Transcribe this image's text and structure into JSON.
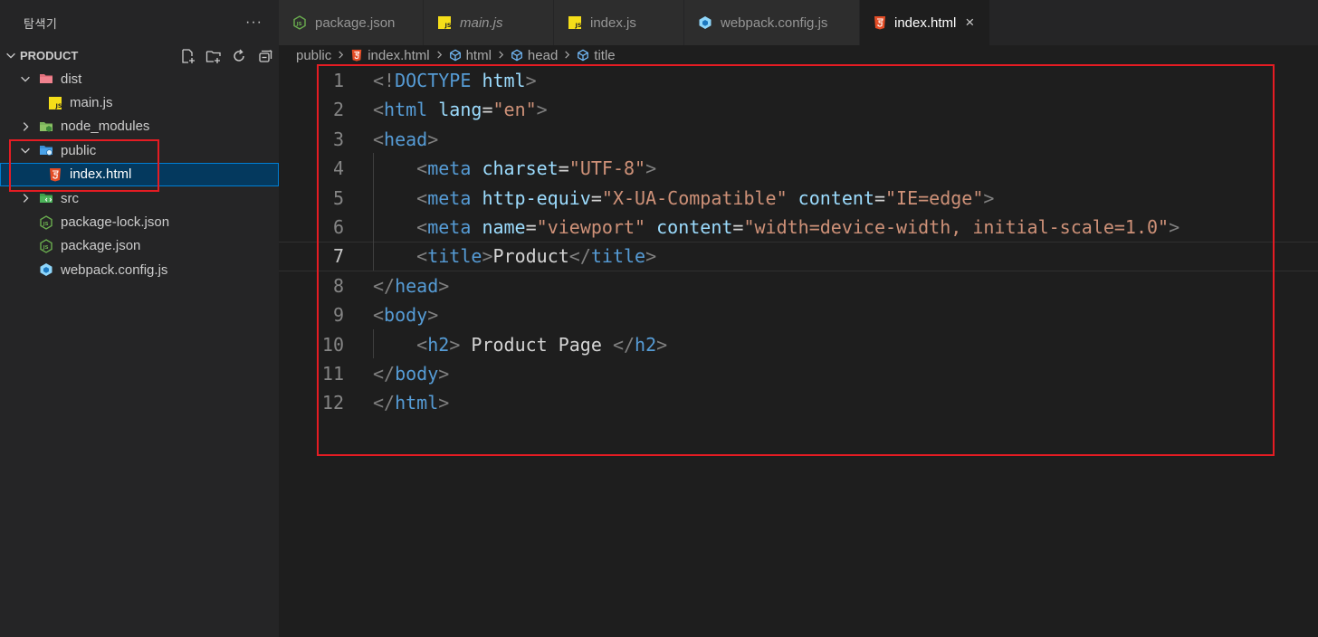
{
  "sidebar": {
    "title": "탐색기",
    "more": "···",
    "section": "PRODUCT",
    "items": [
      {
        "label": "dist"
      },
      {
        "label": "main.js"
      },
      {
        "label": "node_modules"
      },
      {
        "label": "public"
      },
      {
        "label": "index.html"
      },
      {
        "label": "src"
      },
      {
        "label": "package-lock.json"
      },
      {
        "label": "package.json"
      },
      {
        "label": "webpack.config.js"
      }
    ]
  },
  "tabs": [
    {
      "label": "package.json"
    },
    {
      "label": "main.js"
    },
    {
      "label": "index.js"
    },
    {
      "label": "webpack.config.js"
    },
    {
      "label": "index.html",
      "close": "×"
    }
  ],
  "breadcrumb": [
    "public",
    "index.html",
    "html",
    "head",
    "title"
  ],
  "code": {
    "line_numbers": [
      "1",
      "2",
      "3",
      "4",
      "5",
      "6",
      "7",
      "8",
      "9",
      "10",
      "11",
      "12"
    ],
    "current_line": "7",
    "lines": [
      [
        {
          "t": "<!",
          "c": "br"
        },
        {
          "t": "DOCTYPE",
          "c": "tag"
        },
        {
          "t": " ",
          "c": "txt"
        },
        {
          "t": "html",
          "c": "attr"
        },
        {
          "t": ">",
          "c": "br"
        }
      ],
      [
        {
          "t": "<",
          "c": "br"
        },
        {
          "t": "html",
          "c": "tag"
        },
        {
          "t": " ",
          "c": "txt"
        },
        {
          "t": "lang",
          "c": "attr"
        },
        {
          "t": "=",
          "c": "txt"
        },
        {
          "t": "\"en\"",
          "c": "str"
        },
        {
          "t": ">",
          "c": "br"
        }
      ],
      [
        {
          "t": "<",
          "c": "br"
        },
        {
          "t": "head",
          "c": "tag"
        },
        {
          "t": ">",
          "c": "br"
        }
      ],
      [
        {
          "t": "    ",
          "c": "txt"
        },
        {
          "t": "<",
          "c": "br"
        },
        {
          "t": "meta",
          "c": "tag"
        },
        {
          "t": " ",
          "c": "txt"
        },
        {
          "t": "charset",
          "c": "attr"
        },
        {
          "t": "=",
          "c": "txt"
        },
        {
          "t": "\"UTF-8\"",
          "c": "str"
        },
        {
          "t": ">",
          "c": "br"
        }
      ],
      [
        {
          "t": "    ",
          "c": "txt"
        },
        {
          "t": "<",
          "c": "br"
        },
        {
          "t": "meta",
          "c": "tag"
        },
        {
          "t": " ",
          "c": "txt"
        },
        {
          "t": "http-equiv",
          "c": "attr"
        },
        {
          "t": "=",
          "c": "txt"
        },
        {
          "t": "\"X-UA-Compatible\"",
          "c": "str"
        },
        {
          "t": " ",
          "c": "txt"
        },
        {
          "t": "content",
          "c": "attr"
        },
        {
          "t": "=",
          "c": "txt"
        },
        {
          "t": "\"IE=edge\"",
          "c": "str"
        },
        {
          "t": ">",
          "c": "br"
        }
      ],
      [
        {
          "t": "    ",
          "c": "txt"
        },
        {
          "t": "<",
          "c": "br"
        },
        {
          "t": "meta",
          "c": "tag"
        },
        {
          "t": " ",
          "c": "txt"
        },
        {
          "t": "name",
          "c": "attr"
        },
        {
          "t": "=",
          "c": "txt"
        },
        {
          "t": "\"viewport\"",
          "c": "str"
        },
        {
          "t": " ",
          "c": "txt"
        },
        {
          "t": "content",
          "c": "attr"
        },
        {
          "t": "=",
          "c": "txt"
        },
        {
          "t": "\"width=device-width, initial-scale=1.0\"",
          "c": "str"
        },
        {
          "t": ">",
          "c": "br"
        }
      ],
      [
        {
          "t": "    ",
          "c": "txt"
        },
        {
          "t": "<",
          "c": "br"
        },
        {
          "t": "title",
          "c": "tag"
        },
        {
          "t": ">",
          "c": "br"
        },
        {
          "t": "Product",
          "c": "txt"
        },
        {
          "t": "</",
          "c": "br"
        },
        {
          "t": "title",
          "c": "tag"
        },
        {
          "t": ">",
          "c": "br"
        }
      ],
      [
        {
          "t": "</",
          "c": "br"
        },
        {
          "t": "head",
          "c": "tag"
        },
        {
          "t": ">",
          "c": "br"
        }
      ],
      [
        {
          "t": "<",
          "c": "br"
        },
        {
          "t": "body",
          "c": "tag"
        },
        {
          "t": ">",
          "c": "br"
        }
      ],
      [
        {
          "t": "    ",
          "c": "txt"
        },
        {
          "t": "<",
          "c": "br"
        },
        {
          "t": "h2",
          "c": "tag"
        },
        {
          "t": ">",
          "c": "br"
        },
        {
          "t": " Product Page ",
          "c": "txt"
        },
        {
          "t": "</",
          "c": "br"
        },
        {
          "t": "h2",
          "c": "tag"
        },
        {
          "t": ">",
          "c": "br"
        }
      ],
      [
        {
          "t": "</",
          "c": "br"
        },
        {
          "t": "body",
          "c": "tag"
        },
        {
          "t": ">",
          "c": "br"
        }
      ],
      [
        {
          "t": "</",
          "c": "br"
        },
        {
          "t": "html",
          "c": "tag"
        },
        {
          "t": ">",
          "c": "br"
        }
      ]
    ]
  },
  "colors": {
    "tag": "#569cd6",
    "attr": "#9cdcfe",
    "string": "#ce9178",
    "bracket": "#808080",
    "text": "#d4d4d4",
    "highlight_box": "#e51c23"
  }
}
